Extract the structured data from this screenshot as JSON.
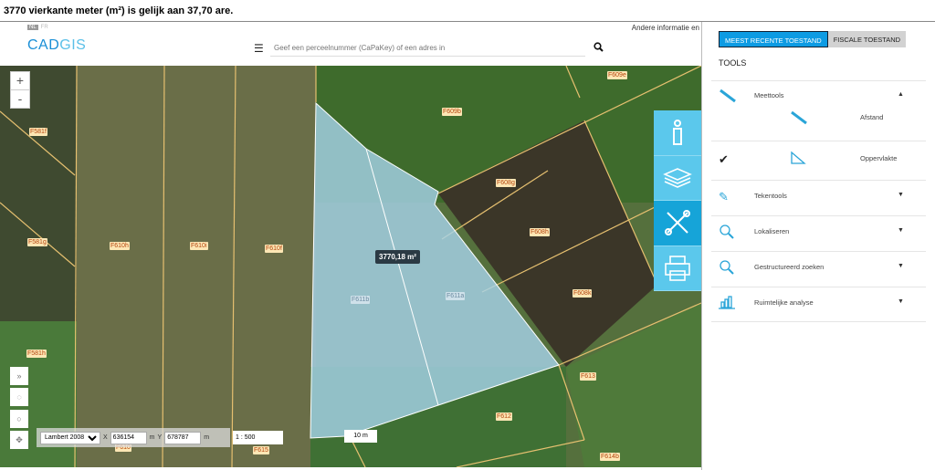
{
  "caption": "3770 vierkante meter (m²) is gelijk aan 37,70 are.",
  "header": {
    "lang_nl": "NL",
    "lang_fr": "FR",
    "other_info": "Andere informatie en",
    "logo_cad": "CAD",
    "logo_gis": "GIS",
    "search_placeholder": "Geef een perceelnummer (CaPaKey) of een adres in"
  },
  "map": {
    "zoom_in": "+",
    "zoom_out": "-",
    "measurement": "3770,18 m²",
    "parcels": [
      "F609e",
      "F609b",
      "F608g",
      "F608h",
      "F608k",
      "F613",
      "F612",
      "F614b",
      "F615",
      "F610",
      "F611b",
      "F611a",
      "F581f",
      "F581g",
      "F581h",
      "F610h",
      "F610i",
      "F610f"
    ],
    "expand": "»",
    "projection": "Lambert 2008",
    "x_label": "X",
    "x_value": "636154",
    "x_unit": "m",
    "y_label": "Y",
    "y_value": "678787",
    "y_unit": "m",
    "scale": "1 : 500",
    "scalebar": "10 m"
  },
  "sidebar": {
    "tab_recent": "MEEST RECENTE TOESTAND",
    "tab_fiscal": "FISCALE TOESTAND",
    "tools_title": "TOOLS",
    "items": [
      {
        "label": "Meettools",
        "icon": "ruler-icon",
        "expanded": true
      },
      {
        "label": "Afstand",
        "icon": "ruler-icon"
      },
      {
        "label": "Oppervlakte",
        "icon": "set-square-icon",
        "checked": true
      },
      {
        "label": "Tekentools",
        "icon": "pen-icon"
      },
      {
        "label": "Lokaliseren",
        "icon": "locate-icon"
      },
      {
        "label": "Gestructureerd zoeken",
        "icon": "search-icon"
      },
      {
        "label": "Ruimtelijke analyse",
        "icon": "chart-icon"
      }
    ]
  },
  "colors": {
    "accent": "#0d9be3",
    "side_button": "#5bc8ec",
    "parcel_label_bg": "#fde7b5",
    "selection": "#a8d4ec"
  }
}
